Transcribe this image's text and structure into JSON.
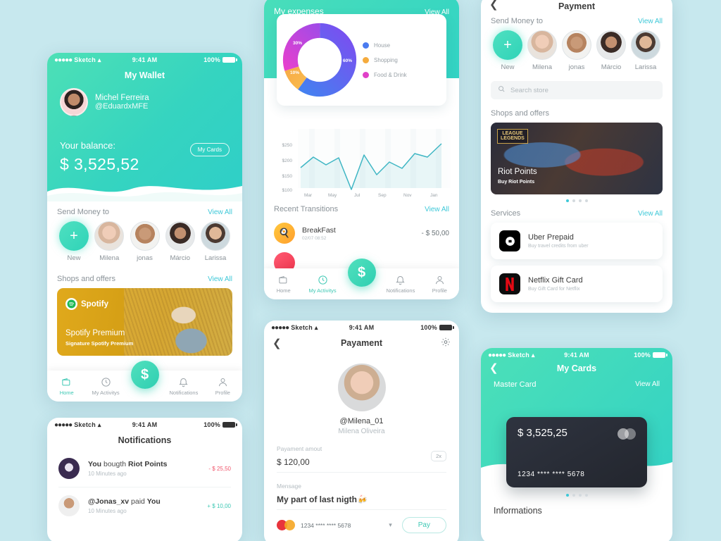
{
  "background_color": "#c7e8ee",
  "accent": {
    "teal": "#3ec8b4",
    "cyan_link": "#3ec8d8",
    "negative": "#f0566c",
    "positive": "#3ec8b4"
  },
  "status_bar": {
    "carrier": "Sketch",
    "dots": "●●●●●",
    "time": "9:41 AM",
    "battery": "100%",
    "wifi_icon": "wifi-icon"
  },
  "wallet": {
    "title": "My Wallet",
    "user_name": "Michel Ferreira",
    "user_handle": "@EduardxMFE",
    "balance_label": "Your balance:",
    "balance_value": "$ 3,525,52",
    "my_cards_button": "My Cards",
    "send_money": {
      "title": "Send Money to",
      "view_all": "View All",
      "contacts": [
        {
          "label": "New",
          "type": "add"
        },
        {
          "label": "Milena",
          "type": "avatar"
        },
        {
          "label": "jonas",
          "type": "avatar"
        },
        {
          "label": "Márcio",
          "type": "avatar"
        },
        {
          "label": "Larissa",
          "type": "avatar"
        }
      ]
    },
    "shops": {
      "title": "Shops and offers",
      "view_all": "View All",
      "banner_brand": "Spotify",
      "banner_title": "Spotify Premium",
      "banner_subtitle": "Signature Spotify Premium"
    },
    "bottom_nav": [
      {
        "label": "Home",
        "icon": "wallet-icon",
        "active": true
      },
      {
        "label": "My Activitys",
        "icon": "clock-icon",
        "active": false
      },
      {
        "label": "Notifications",
        "icon": "bell-icon",
        "active": false
      },
      {
        "label": "Profile",
        "icon": "person-icon",
        "active": false
      }
    ],
    "fab_label": "$"
  },
  "expenses": {
    "title": "My expenses",
    "view_all": "View All",
    "recent_title": "Recent Transitions",
    "recent_view_all": "View All",
    "transactions": [
      {
        "name": "BreakFast",
        "date": "02/07 08:52",
        "amount": "- $ 50,00",
        "icon": "breakfast-icon"
      }
    ],
    "bottom_nav": [
      {
        "label": "Home",
        "icon": "wallet-icon",
        "active": false
      },
      {
        "label": "My Activitys",
        "icon": "clock-icon",
        "active": true
      },
      {
        "label": "Notifications",
        "icon": "bell-icon",
        "active": false
      },
      {
        "label": "Profile",
        "icon": "person-icon",
        "active": false
      }
    ],
    "fab_label": "$"
  },
  "chart_data": [
    {
      "type": "pie",
      "title": "My expenses",
      "labels": [
        "House",
        "Shopping",
        "Food & Drink"
      ],
      "values": [
        60,
        10,
        30
      ],
      "value_labels": [
        "60%",
        "10%",
        "30%"
      ],
      "colors": [
        "#4a7bf0",
        "#f5ab3d",
        "#e040c8"
      ],
      "legend_position": "right",
      "donut": true
    },
    {
      "type": "line",
      "title": "",
      "xlabel": "",
      "ylabel": "",
      "x": [
        "Mar",
        "Apr",
        "May",
        "Jun",
        "Jul",
        "Aug",
        "Sep",
        "Oct",
        "Nov",
        "Dec",
        "Jan",
        "Feb"
      ],
      "tick_labels_x": [
        "Mar",
        "May",
        "Jul",
        "Sep",
        "Nov",
        "Jan"
      ],
      "tick_labels_y": [
        "$100",
        "$150",
        "$200",
        "$250"
      ],
      "ylim": [
        85,
        270
      ],
      "values": [
        183,
        217,
        192,
        211,
        100,
        227,
        165,
        203,
        180,
        230,
        217,
        262
      ],
      "line_color": "#3fb6c4",
      "grid": true,
      "area_fill": true
    }
  ],
  "store": {
    "title": "Payment",
    "back_icon": "chevron-left-icon",
    "send_money": {
      "title": "Send Money to",
      "view_all": "View All",
      "contacts": [
        {
          "label": "New",
          "type": "add"
        },
        {
          "label": "Milena",
          "type": "avatar"
        },
        {
          "label": "jonas",
          "type": "avatar"
        },
        {
          "label": "Márcio",
          "type": "avatar"
        },
        {
          "label": "Larissa",
          "type": "avatar"
        }
      ]
    },
    "search_placeholder": "Search store",
    "shops_title": "Shops and offers",
    "banner": {
      "logo_line1": "LEAGUE",
      "logo_line2": "LEGENDS",
      "title": "Riot Points",
      "subtitle": "Buy Riot Points"
    },
    "carousel_dots": 4,
    "carousel_active": 0,
    "services_title": "Services",
    "services_view_all": "View All",
    "services": [
      {
        "name": "Uber Prepaid",
        "desc": "Buy travel credits from uber",
        "icon": "uber-icon"
      },
      {
        "name": "Netflix Gift Card",
        "desc": "Buy Gift Card for Netflix",
        "icon": "netflix-icon"
      }
    ]
  },
  "payament": {
    "title": "Payament",
    "back_icon": "chevron-left-icon",
    "settings_icon": "gear-icon",
    "handle": "@Milena_01",
    "full_name": "Milena Oliveira",
    "amount_label": "Payament amout",
    "amount_value": "$ 120,00",
    "multiplier": "2x",
    "message_label": "Mensage",
    "message_value": "My part of last nigth🍻",
    "card_number": "1234 **** **** 5678",
    "card_icon": "mastercard-icon",
    "dropdown_icon": "chevron-down-icon",
    "pay_button": "Pay"
  },
  "notifications": {
    "title": "Notifications",
    "items": [
      {
        "prefix": "You",
        "action": " bougth ",
        "subject": "Riot Points",
        "time": "10 Minutes ago",
        "amount": "- $ 25,50",
        "sign": "neg",
        "avatar": "lol-avatar"
      },
      {
        "prefix": "@Jonas_xv",
        "action": " paid ",
        "subject": "You",
        "time": "10 Minutes ago",
        "amount": "+ $ 10,00",
        "sign": "pos",
        "avatar": "jonas-avatar"
      }
    ]
  },
  "mycards": {
    "title": "My Cards",
    "back_icon": "chevron-left-icon",
    "card_type": "Master Card",
    "view_all": "View All",
    "card_amount": "$ 3,525,25",
    "card_number": "1234 **** **** 5678",
    "carousel_dots": 4,
    "carousel_active": 0,
    "info_title": "Informations"
  }
}
